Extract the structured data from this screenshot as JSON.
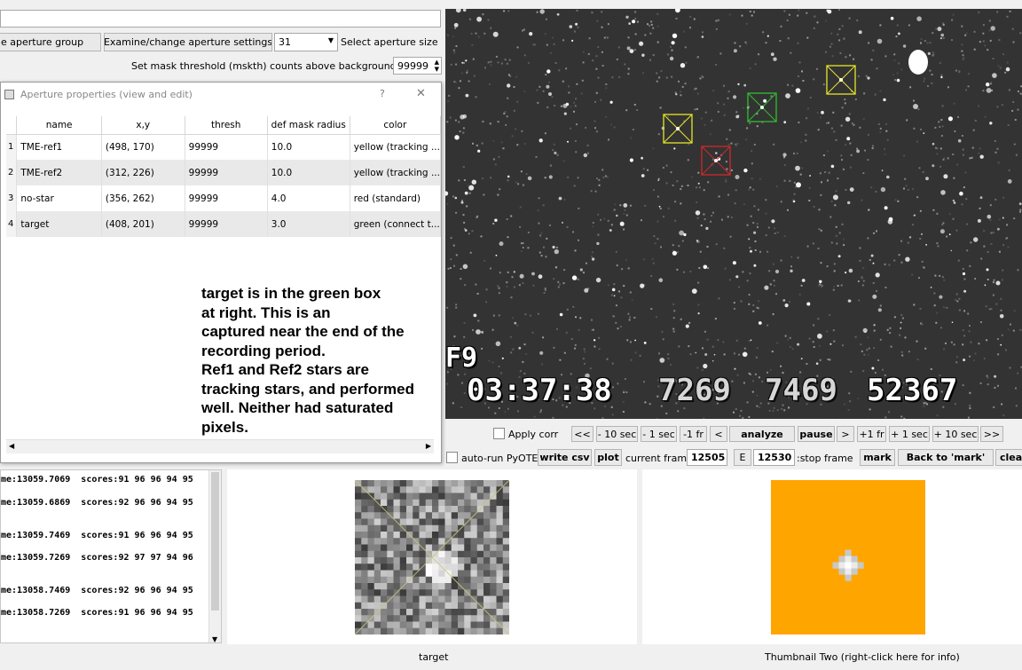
{
  "top": {
    "aperture_group_btn": "e aperture group",
    "examine_btn": "Examine/change aperture settings",
    "aperture_size_value": "31",
    "aperture_size_label": "Select aperture size",
    "mask_threshold_label": "Set mask threshold (mskth) counts above background (bkavg)",
    "mask_threshold_value": "99999"
  },
  "dialog": {
    "title": "Aperture properties (view and edit)",
    "help": "?",
    "close": "✕",
    "columns": [
      "name",
      "x,y",
      "thresh",
      "def mask radius",
      "color"
    ],
    "rows": [
      {
        "n": "1",
        "name": "TME-ref1",
        "xy": "(498, 170)",
        "thresh": "99999",
        "radius": "10.0",
        "color": "yellow (tracking ..."
      },
      {
        "n": "2",
        "name": "TME-ref2",
        "xy": "(312, 226)",
        "thresh": "99999",
        "radius": "10.0",
        "color": "yellow (tracking ..."
      },
      {
        "n": "3",
        "name": "no-star",
        "xy": "(356, 262)",
        "thresh": "99999",
        "radius": "4.0",
        "color": "red (standard)"
      },
      {
        "n": "4",
        "name": "target",
        "xy": "(408, 201)",
        "thresh": "99999",
        "radius": "3.0",
        "color": "green (connect t..."
      }
    ],
    "note_lines": [
      "target is in the green box",
      "at right. This is an",
      "captured near the end of the",
      "recording period.",
      "Ref1 and Ref2 stars are",
      "tracking stars, and performed",
      "well. Neither had saturated",
      "pixels."
    ]
  },
  "video": {
    "osd_field": "F9",
    "osd_time": "03:37:38",
    "osd_n1": "7269",
    "osd_n2": "7469",
    "osd_n3": "52367"
  },
  "controls": {
    "apply_corr": "Apply corr",
    "back_big": "<<",
    "back_10": "- 10 sec",
    "back_1": "- 1 sec",
    "back_fr": "-1 fr",
    "back_one": "<",
    "analyze": "analyze",
    "pause": "pause",
    "fwd_one": ">",
    "fwd_fr": "+1 fr",
    "fwd_1": "+ 1 sec",
    "fwd_10": "+ 10 sec",
    "fwd_big": ">>",
    "auto_run": "auto-run PyOTE",
    "write_csv": "write csv",
    "plot": "plot",
    "current_frame_label": "current frame:",
    "current_frame": "12505",
    "e_btn": "E",
    "stop_frame": "12530",
    "stop_frame_label": ":stop frame",
    "mark": "mark",
    "back_to_mark": "Back to 'mark'",
    "clear": "clear"
  },
  "log": [
    "me:13059.7069  scores:91 96 96 94 95",
    "me:13059.6869  scores:92 96 96 94 95",
    "me:13059.7469  scores:91 96 96 94 95",
    "me:13059.7269  scores:92 97 97 94 96",
    "me:13058.7469  scores:92 96 96 94 95",
    "me:13058.7269  scores:91 96 96 94 95"
  ],
  "thumbs": {
    "one_label": "target",
    "two_label": "Thumbnail Two (right-click here for info)"
  },
  "colors": {
    "thumb_two_bg": "#ffa500",
    "box_yellow": "#e6e62a",
    "box_green": "#2fbf2f",
    "box_red": "#d02a2a"
  }
}
